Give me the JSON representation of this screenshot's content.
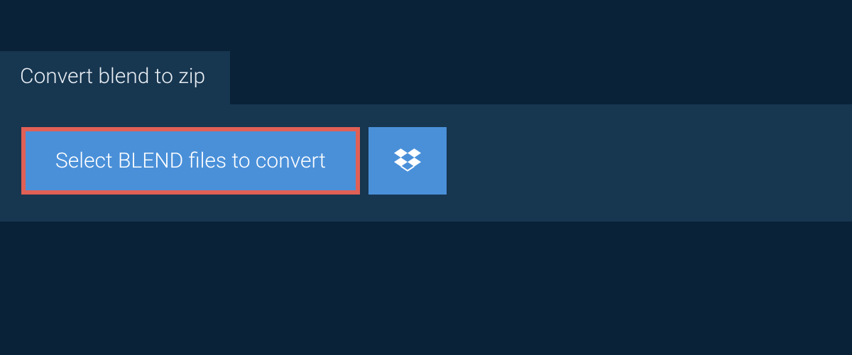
{
  "tab": {
    "label": "Convert blend to zip"
  },
  "upload": {
    "select_label": "Select BLEND files to convert"
  }
}
